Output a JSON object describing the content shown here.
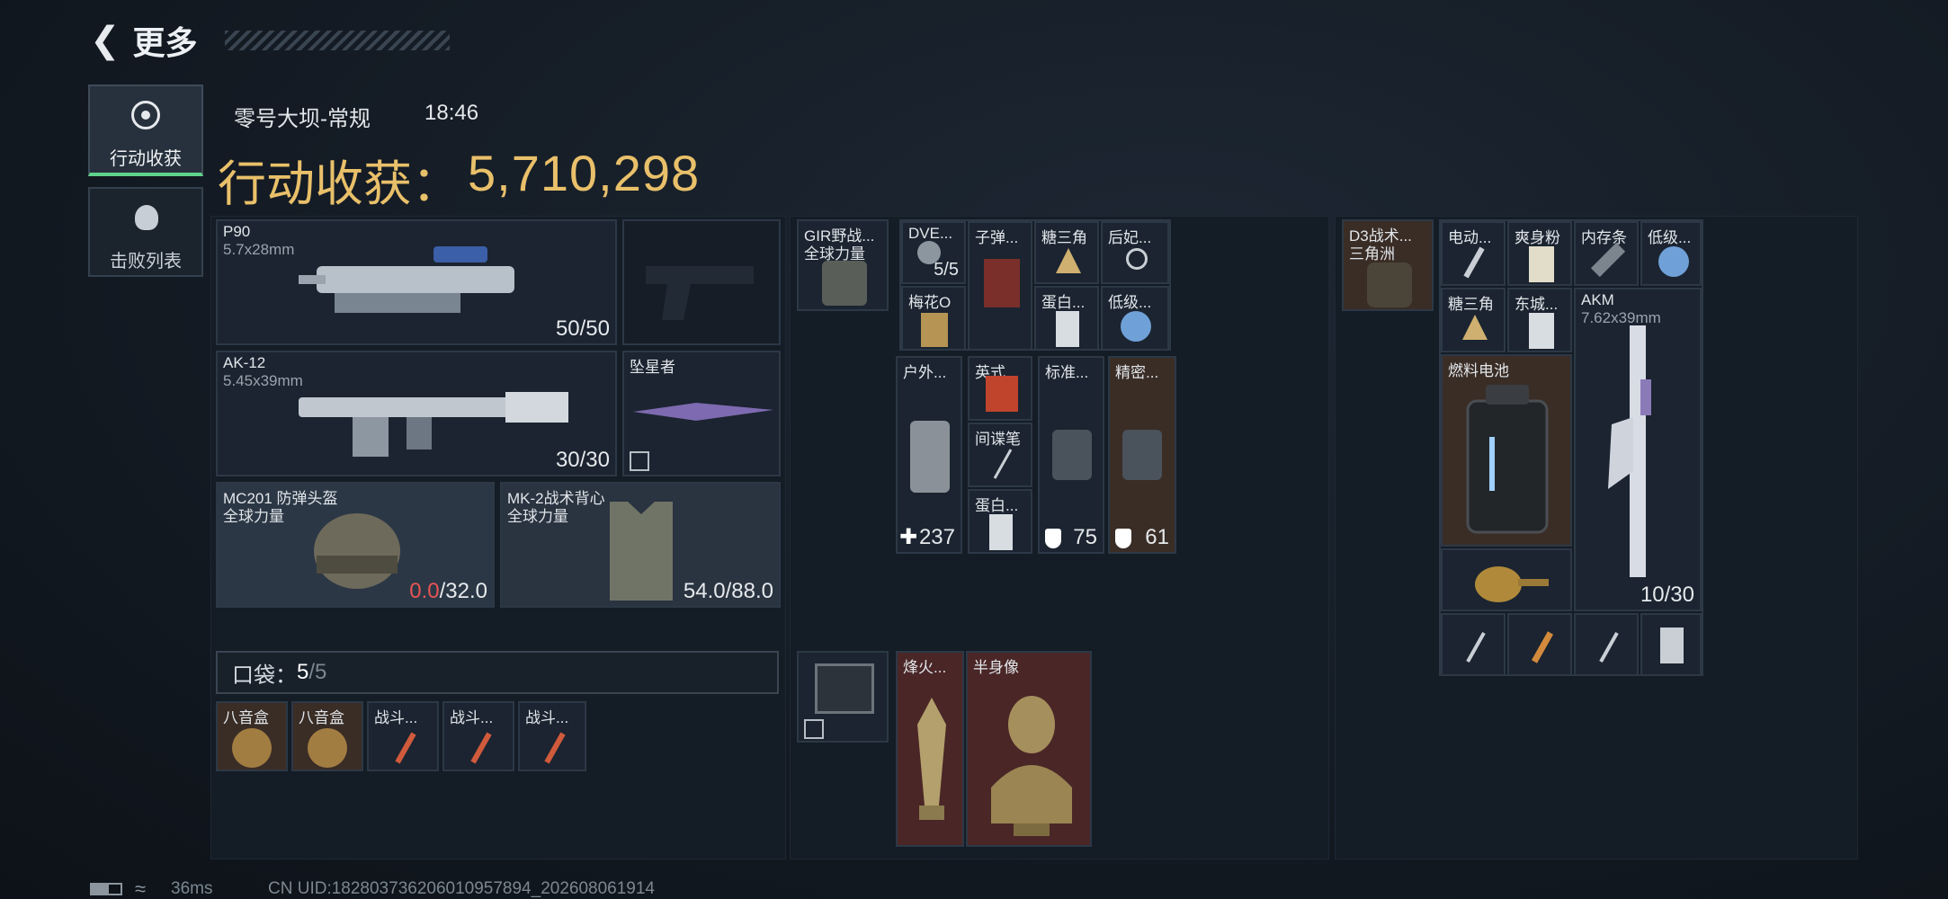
{
  "header": {
    "back_label": "更多"
  },
  "side_tabs": [
    {
      "label": "行动收获",
      "icon": "target-icon"
    },
    {
      "label": "击败列表",
      "icon": "skull-icon"
    }
  ],
  "match": {
    "map": "零号大坝-常规",
    "time": "18:46",
    "earnings_label": "行动收获：",
    "earnings_value": "5,710,298"
  },
  "loadout": {
    "primary1": {
      "name": "P90",
      "ammo_type": "5.7x28mm",
      "ammo": "50/50"
    },
    "primary2": {
      "name": "AK-12",
      "ammo_type": "5.45x39mm",
      "ammo": "30/30"
    },
    "melee": {
      "name": "坠星者"
    },
    "helmet": {
      "name": "MC201 防弹头盔",
      "maker": "全球力量",
      "durability_current": "0.0",
      "durability_max": "/32.0"
    },
    "vest": {
      "name": "MK-2战术背心",
      "maker": "全球力量",
      "durability": "54.0/88.0"
    }
  },
  "pocket": {
    "label": "口袋：",
    "count": "5",
    "total": "/5",
    "items": [
      {
        "name": "八音盒"
      },
      {
        "name": "八音盒"
      },
      {
        "name": "战斗..."
      },
      {
        "name": "战斗..."
      },
      {
        "name": "战斗..."
      }
    ]
  },
  "chest_rig": {
    "name": "GIR野战...",
    "maker": "全球力量",
    "items": [
      {
        "name": "DVE...",
        "qty": "5/5"
      },
      {
        "name": "子弹..."
      },
      {
        "name": "糖三角"
      },
      {
        "name": "后妃..."
      },
      {
        "name": "梅花O"
      },
      {
        "name": "蛋白..."
      },
      {
        "name": "低级..."
      }
    ]
  },
  "meds": [
    {
      "name": "户外...",
      "qty": "237"
    },
    {
      "name": "英式..."
    },
    {
      "name": "间谍笔"
    },
    {
      "name": "蛋白..."
    },
    {
      "name": "标准...",
      "qty": "75"
    },
    {
      "name": "精密...",
      "qty": "61"
    }
  ],
  "case": {
    "items": [
      {
        "name": "烽火..."
      },
      {
        "name": "半身像"
      }
    ]
  },
  "backpack": {
    "name": "D3战术...",
    "maker": "三角洲",
    "items": [
      {
        "name": "电动..."
      },
      {
        "name": "爽身粉"
      },
      {
        "name": "内存条"
      },
      {
        "name": "低级..."
      },
      {
        "name": "糖三角"
      },
      {
        "name": "东城..."
      },
      {
        "name": "AKM",
        "sub": "7.62x39mm",
        "qty": "10/30"
      },
      {
        "name": "燃料电池"
      }
    ]
  },
  "status": {
    "ping": "36ms",
    "uid": "CN UID:182803736206010957894_202608061914"
  }
}
